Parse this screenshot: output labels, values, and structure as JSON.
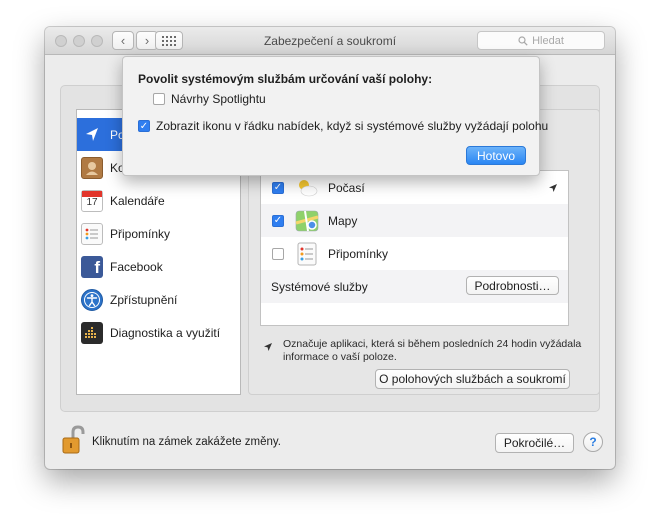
{
  "window": {
    "title": "Zabezpečení a soukromí",
    "search_placeholder": "Hledat"
  },
  "sidebar": {
    "items": [
      {
        "label": "Po",
        "icon": "location-arrow-icon",
        "selected": true
      },
      {
        "label": "Ko",
        "icon": "contacts-icon",
        "selected": false
      },
      {
        "label": "Kalendáře",
        "icon": "calendar-icon",
        "selected": false,
        "icon_text": "17"
      },
      {
        "label": "Připomínky",
        "icon": "reminders-icon",
        "selected": false
      },
      {
        "label": "Facebook",
        "icon": "facebook-icon",
        "selected": false,
        "icon_text": "f"
      },
      {
        "label": "Zpřístupnění",
        "icon": "accessibility-icon",
        "selected": false
      },
      {
        "label": "Diagnostika a využití",
        "icon": "diagnostics-icon",
        "selected": false
      }
    ]
  },
  "apps": {
    "rows": [
      {
        "label": "Počasí",
        "checked": true,
        "icon": "weather-icon",
        "location_arrow": true
      },
      {
        "label": "Mapy",
        "checked": true,
        "icon": "maps-icon",
        "location_arrow": false
      },
      {
        "label": "Připomínky",
        "checked": false,
        "icon": "reminders-icon",
        "location_arrow": false
      }
    ],
    "system_services_label": "Systémové služby",
    "details_button": "Podrobnosti…"
  },
  "note": {
    "text": "Označuje aplikaci, která si během posledních 24 hodin vyžádala informace o vaší poloze."
  },
  "about_button": "O polohových službách a soukromí",
  "footer": {
    "lock_text": "Kliknutím na zámek zakážete změny.",
    "advanced_button": "Pokročilé…",
    "help_label": "?"
  },
  "popover": {
    "title": "Povolit systémovým službám určování vaší polohy:",
    "option_spotlight": "Návrhy Spotlightu",
    "option_spotlight_checked": false,
    "option_menubar": "Zobrazit ikonu v řádku nabídek, když si systémové služby vyžádají polohu",
    "option_menubar_checked": true,
    "done_button": "Hotovo"
  },
  "colors": {
    "accent": "#2c6fdc",
    "checkbox": "#2f7ef0"
  }
}
